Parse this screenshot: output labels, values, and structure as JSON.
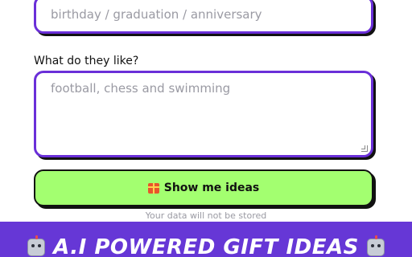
{
  "form": {
    "occasion_placeholder": "birthday / graduation / anniversary",
    "likes_label": "What do they like?",
    "likes_placeholder": "football, chess and swimming",
    "submit_label": "Show me ideas",
    "submit_icon": "gift-icon",
    "privacy_note": "Your data will not be stored"
  },
  "banner": {
    "title": "A.I POWERED GIFT IDEAS",
    "icon": "robot-icon"
  },
  "colors": {
    "accent_border": "#6a2fd8",
    "button_bg": "#a3ff70",
    "banner_bg": "#6637d6"
  }
}
